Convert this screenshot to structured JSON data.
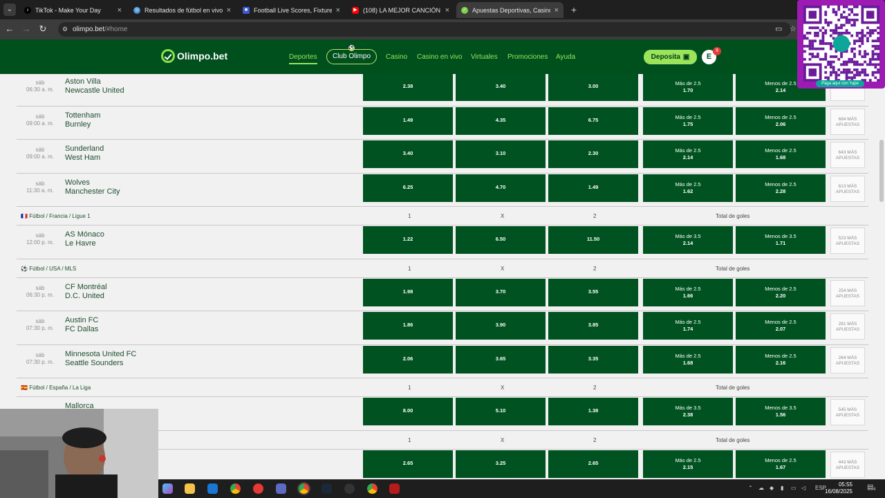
{
  "browser": {
    "tabs": [
      {
        "title": "TikTok - Make Your Day",
        "icon": "tiktok-icon",
        "color": "#000000"
      },
      {
        "title": "Resultados de fútbol en vivo, M",
        "icon": "globe-icon",
        "color": "#4a90d9"
      },
      {
        "title": "Football Live Scores, Fixtures &",
        "icon": "fs-icon",
        "color": "#3c5ad6"
      },
      {
        "title": "(108) LA MEJOR CANCIÓN DE I",
        "icon": "youtube-icon",
        "color": "#ff0000"
      },
      {
        "title": "Apuestas Deportivas, Casino O",
        "icon": "olimpo-icon",
        "color": "#7cd04a"
      }
    ],
    "url_host": "olimpo.bet",
    "url_path": "/#home"
  },
  "site": {
    "logo_text": "Olimpo.bet",
    "nav": [
      "Deportes",
      "Club Olimpo",
      "Casino",
      "Casino en vivo",
      "Virtuales",
      "Promociones",
      "Ayuda"
    ],
    "deposit_label": "Deposita",
    "avatar_letter": "E",
    "notif_count": "9",
    "colors": {
      "header": "#00501e",
      "accent": "#9be35a",
      "odd_bg": "#005321"
    }
  },
  "qr": {
    "label": "Paga aquí con Yape",
    "brand": "yape"
  },
  "league_cols": {
    "c1": "1",
    "cx": "X",
    "c2": "2",
    "total": "Total de goles"
  },
  "matches_epl": [
    {
      "day": "sáb",
      "time": "06:30 a. m.",
      "home": "Aston Villa",
      "away": "Newcastle United",
      "o1": "2.38",
      "ox": "3.40",
      "o2": "3.00",
      "over_label": "Más de 2.5",
      "over": "1.70",
      "under_label": "Menos de 2.5",
      "under": "2.14",
      "more": "APUESTAS"
    },
    {
      "day": "sáb",
      "time": "09:00 a. m.",
      "home": "Tottenham",
      "away": "Burnley",
      "o1": "1.49",
      "ox": "4.35",
      "o2": "6.75",
      "over_label": "Más de 2.5",
      "over": "1.75",
      "under_label": "Menos de 2.5",
      "under": "2.06",
      "more": "684 MÁS APUESTAS"
    },
    {
      "day": "sáb",
      "time": "09:00 a. m.",
      "home": "Sunderland",
      "away": "West Ham",
      "o1": "3.40",
      "ox": "3.10",
      "o2": "2.30",
      "over_label": "Más de 2.5",
      "over": "2.14",
      "under_label": "Menos de 2.5",
      "under": "1.68",
      "more": "643 MÁS APUESTAS"
    },
    {
      "day": "sáb",
      "time": "11:30 a. m.",
      "home": "Wolves",
      "away": "Manchester City",
      "o1": "6.25",
      "ox": "4.70",
      "o2": "1.49",
      "over_label": "Más de 2.5",
      "over": "1.62",
      "under_label": "Menos de 2.5",
      "under": "2.28",
      "more": "613 MÁS APUESTAS"
    }
  ],
  "league_fr": {
    "name": "Fútbol / Francia / Ligue 1",
    "icon": "france-flag-icon"
  },
  "matches_fr": [
    {
      "day": "sáb",
      "time": "12:00 p. m.",
      "home": "AS Mónaco",
      "away": "Le Havre",
      "o1": "1.22",
      "ox": "6.50",
      "o2": "11.50",
      "over_label": "Más de 3.5",
      "over": "2.14",
      "under_label": "Menos de 3.5",
      "under": "1.71",
      "more": "523 MÁS APUESTAS"
    }
  ],
  "league_mls": {
    "name": "Fútbol / USA / MLS",
    "icon": "soccer-ball-icon"
  },
  "matches_mls": [
    {
      "day": "sáb",
      "time": "06:30 p. m.",
      "home": "CF Montréal",
      "away": "D.C. United",
      "o1": "1.98",
      "ox": "3.70",
      "o2": "3.55",
      "over_label": "Más de 2.5",
      "over": "1.66",
      "under_label": "Menos de 2.5",
      "under": "2.20",
      "more": "254 MÁS APUESTAS"
    },
    {
      "day": "sáb",
      "time": "07:30 p. m.",
      "home": "Austin FC",
      "away": "FC Dallas",
      "o1": "1.86",
      "ox": "3.90",
      "o2": "3.85",
      "over_label": "Más de 2.5",
      "over": "1.74",
      "under_label": "Menos de 2.5",
      "under": "2.07",
      "more": "281 MÁS APUESTAS"
    },
    {
      "day": "sáb",
      "time": "07:30 p. m.",
      "home": "Minnesota United FC",
      "away": "Seattle Sounders",
      "o1": "2.06",
      "ox": "3.65",
      "o2": "3.35",
      "over_label": "Más de 2.5",
      "over": "1.68",
      "under_label": "Menos de 2.5",
      "under": "2.16",
      "more": "264 MÁS APUESTAS"
    }
  ],
  "league_es": {
    "name": "Fútbol / España / La Liga",
    "icon": "spain-flag-icon"
  },
  "matches_es": [
    {
      "day": "",
      "time": "",
      "home": "Mallorca",
      "away": "",
      "o1": "8.00",
      "ox": "5.10",
      "o2": "1.38",
      "over_label": "Más de 3.5",
      "over": "2.38",
      "under_label": "Menos de 3.5",
      "under": "1.56",
      "more": "545 MÁS APUESTAS"
    }
  ],
  "matches_es2": [
    {
      "day": "",
      "time": "",
      "home": "",
      "away": "",
      "o1": "2.65",
      "ox": "3.25",
      "o2": "2.65",
      "over_label": "Más de 2.5",
      "over": "2.15",
      "under_label": "Menos de 2.5",
      "under": "1.67",
      "more": "443 MÁS APUESTAS"
    }
  ],
  "taskbar": {
    "lang": "ESP",
    "time": "05:55",
    "date": "16/08/2025",
    "notif": "4"
  }
}
